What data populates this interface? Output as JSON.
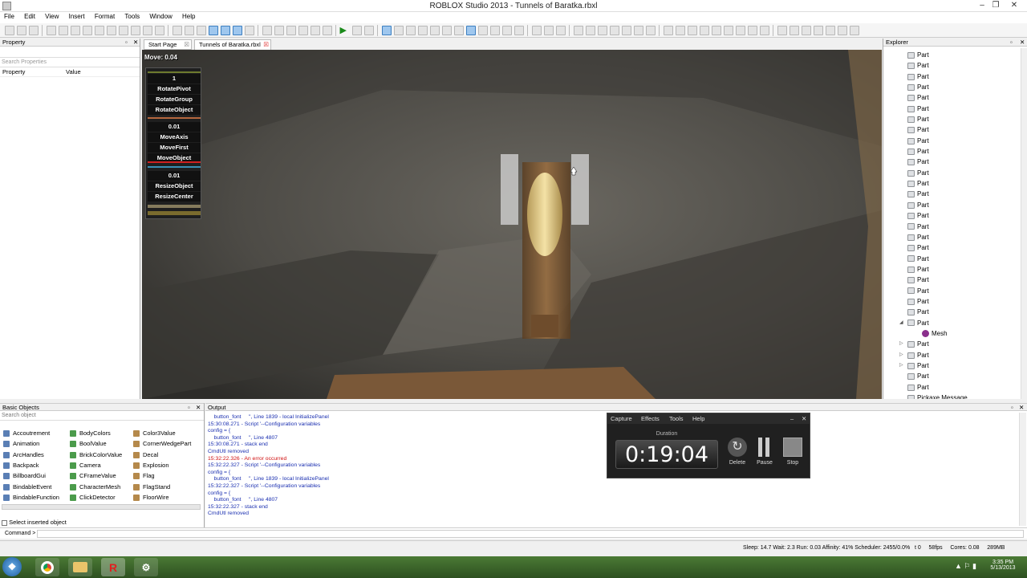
{
  "window": {
    "title": "ROBLOX Studio 2013 - Tunnels of Baratka.rbxl"
  },
  "menu": [
    "File",
    "Edit",
    "View",
    "Insert",
    "Format",
    "Tools",
    "Window",
    "Help"
  ],
  "properties": {
    "title": "Property",
    "search_placeholder": "Search Properties",
    "col_property": "Property",
    "col_value": "Value"
  },
  "tabs": [
    {
      "label": "Start Page"
    },
    {
      "label": "Tunnels of Baratka.rbxl"
    }
  ],
  "viewport": {
    "move_label": "Move: 0.04"
  },
  "movepanel": {
    "items": [
      "1",
      "RotatePivot",
      "RotateGroup",
      "RotateObject",
      "0.01",
      "MoveAxis",
      "MoveFirst",
      "MoveObject",
      "0.01",
      "ResizeObject",
      "ResizeCenter"
    ]
  },
  "explorer": {
    "title": "Explorer",
    "nodes": [
      "Part",
      "Part",
      "Part",
      "Part",
      "Part",
      "Part",
      "Part",
      "Part",
      "Part",
      "Part",
      "Part",
      "Part",
      "Part",
      "Part",
      "Part",
      "Part",
      "Part",
      "Part",
      "Part",
      "Part",
      "Part",
      "Part",
      "Part",
      "Part",
      "Part",
      "Part",
      "Mesh",
      "Part",
      "Part",
      "Part",
      "Part",
      "Part",
      "Pickaxe Message"
    ]
  },
  "basic_objects": {
    "title": "Basic Objects",
    "search_placeholder": "Search object",
    "col1": [
      "Accoutrement",
      "Animation",
      "ArcHandles",
      "Backpack",
      "BillboardGui",
      "BindableEvent",
      "BindableFunction"
    ],
    "col2": [
      "BodyColors",
      "BoolValue",
      "BrickColorValue",
      "Camera",
      "CFrameValue",
      "CharacterMesh",
      "ClickDetector"
    ],
    "col3": [
      "Color3Value",
      "CornerWedgePart",
      "Decal",
      "Explosion",
      "Flag",
      "FlagStand",
      "FloorWire"
    ],
    "select_label": "Select inserted object"
  },
  "output": {
    "title": "Output",
    "lines": [
      {
        "text": "    button_font     \", Line 1839 - local InitializePanel",
        "color": "#1a2fb0"
      },
      {
        "text": "15:30:08.271 - Script '--Configuration variables",
        "color": "#1a2fb0"
      },
      {
        "text": "config = {",
        "color": "#1a2fb0"
      },
      {
        "text": "    button_font     \", Line 4807",
        "color": "#1a2fb0"
      },
      {
        "text": "15:30:08.271 - stack end",
        "color": "#1a2fb0"
      },
      {
        "text": "CmdUtl removed",
        "color": "#1a2fb0"
      },
      {
        "text": "15:32:22.326 - An error occurred",
        "color": "#d01010"
      },
      {
        "text": "15:32:22.327 - Script '--Configuration variables",
        "color": "#1a2fb0"
      },
      {
        "text": "config = {",
        "color": "#1a2fb0"
      },
      {
        "text": "    button_font     \", Line 1839 - local InitializePanel",
        "color": "#1a2fb0"
      },
      {
        "text": "15:32:22.327 - Script '--Configuration variables",
        "color": "#1a2fb0"
      },
      {
        "text": "config = {",
        "color": "#1a2fb0"
      },
      {
        "text": "    button_font     \", Line 4807",
        "color": "#1a2fb0"
      },
      {
        "text": "15:32:22.327 - stack end",
        "color": "#1a2fb0"
      },
      {
        "text": "CmdUtl removed",
        "color": "#1a2fb0"
      }
    ]
  },
  "capture": {
    "menu": [
      "Capture",
      "Effects",
      "Tools",
      "Help"
    ],
    "duration_label": "Duration",
    "time": "0:19:04",
    "delete": "Delete",
    "pause": "Pause",
    "stop": "Stop"
  },
  "command": {
    "label": "Command >"
  },
  "status": {
    "text": "Sleep: 14.7 Wait: 2.3 Run: 0.03 Affinity: 41% Scheduler: 2455/0.0%   t 0     58fps     Cores: 0.08     289MB"
  },
  "clock": {
    "time": "3:35 PM",
    "date": "5/13/2013"
  }
}
